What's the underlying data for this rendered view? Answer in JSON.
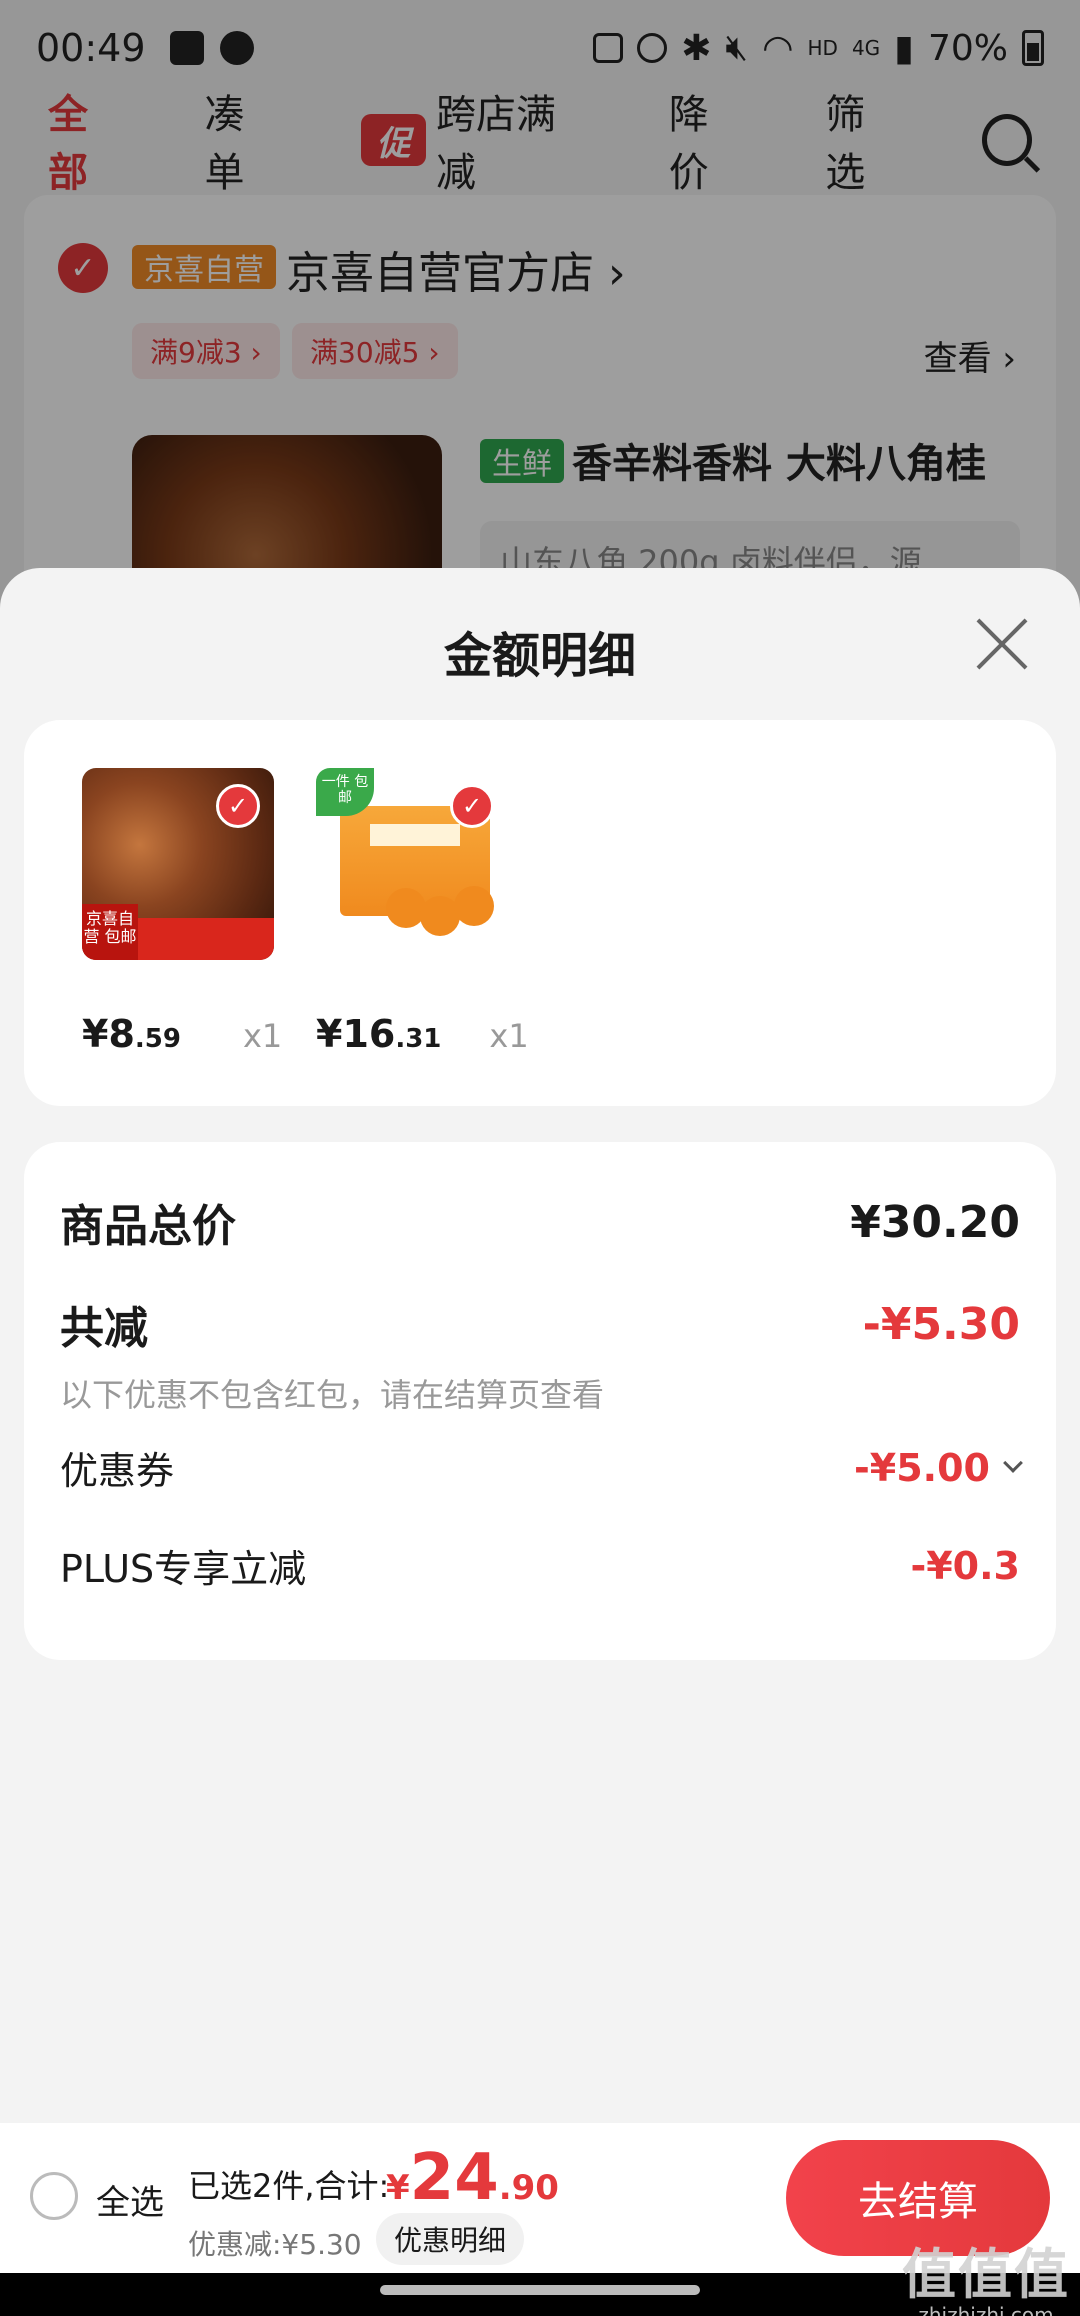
{
  "status_bar": {
    "time": "00:49",
    "network": "4G",
    "battery": "70%"
  },
  "filter_tabs": [
    {
      "label": "全部",
      "active": true
    },
    {
      "label": "凑单",
      "active": false
    },
    {
      "label": "跨店满减",
      "active": false,
      "tag": "促"
    },
    {
      "label": "降价",
      "active": false
    },
    {
      "label": "筛选",
      "active": false
    }
  ],
  "store": {
    "badge": "京喜自营",
    "name": "京喜自营官方店 ›",
    "coupons": [
      "满9减3 ›",
      "满30减5 ›"
    ],
    "view_link": "查看 ›",
    "product": {
      "badge": "生鲜",
      "title": "香辛料香料 大料八角桂",
      "spec": "山东八角 200g 卤料伴侣，源"
    }
  },
  "sheet": {
    "title": "金额明细",
    "items": [
      {
        "price_int": "¥8",
        "price_dec": ".59",
        "qty": "x1",
        "image": "star-anise",
        "img_tag": "京喜自营 包邮"
      },
      {
        "price_int": "¥16",
        "price_dec": ".31",
        "qty": "x1",
        "image": "orange-box",
        "img_tag": "一件 包邮"
      }
    ],
    "summary": {
      "total_label": "商品总价",
      "total_value": "¥30.20",
      "discount_label": "共减",
      "discount_value": "-¥5.30",
      "note": "以下优惠不包含红包，请在结算页查看",
      "coupon_label": "优惠券",
      "coupon_value": "-¥5.00",
      "plus_label": "PLUS专享立减",
      "plus_value": "-¥0.3"
    }
  },
  "checkout": {
    "select_all": "全选",
    "selected_text": "已选2件,合计:",
    "total_currency": "¥",
    "total_int": "24",
    "total_dec": ".90",
    "discount_line": "优惠减:¥5.30",
    "detail_button": "优惠明细",
    "checkout_button": "去结算"
  },
  "watermark": {
    "big": "值值值",
    "small": "zhizhizhi.com"
  },
  "colors": {
    "accent": "#e4393c",
    "self_operated_badge": "#f08c28",
    "fresh_badge": "#2fa84f"
  }
}
